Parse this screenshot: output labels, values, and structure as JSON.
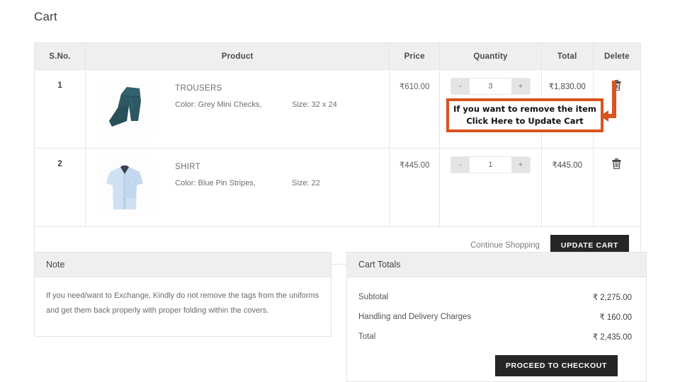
{
  "page": {
    "title": "Cart"
  },
  "table": {
    "headers": {
      "sno": "S.No.",
      "product": "Product",
      "price": "Price",
      "quantity": "Quantity",
      "total": "Total",
      "delete": "Delete"
    },
    "rows": [
      {
        "sno": "1",
        "name": "TROUSERS",
        "color": "Color: Grey Mini Checks,",
        "size": "Size: 32 x 24",
        "price": "₹610.00",
        "qty": "3",
        "total": "₹1,830.00",
        "minus": "-",
        "plus": "+",
        "image": "trousers-thumbnail"
      },
      {
        "sno": "2",
        "name": "SHIRT",
        "color": "Color: Blue Pin Stripes,",
        "size": "Size: 22",
        "price": "₹445.00",
        "qty": "1",
        "total": "₹445.00",
        "minus": "-",
        "plus": "+",
        "image": "shirt-thumbnail"
      }
    ],
    "footer": {
      "continue_shopping": "Continue Shopping",
      "update_cart": "UPDATE CART"
    }
  },
  "annotation": {
    "line1": "If you want to remove the item",
    "line2": "Click Here to Update Cart",
    "color": "#d9531e",
    "points_to": "delete-icon-row-1"
  },
  "note": {
    "heading": "Note",
    "line1": "If you need/want to Exchange, Kindly do not remove the tags from the uniforms",
    "line2": "and get them back properly with proper folding within the covers."
  },
  "totals": {
    "heading": "Cart Totals",
    "rows": [
      {
        "label": "Subtotal",
        "value": "₹ 2,275.00"
      },
      {
        "label": "Handling and Delivery Charges",
        "value": "₹ 160.00"
      },
      {
        "label": "Total",
        "value": "₹ 2,435.00"
      }
    ],
    "checkout_label": "PROCEED TO CHECKOUT"
  },
  "colors": {
    "header_bg": "#efefef",
    "border": "#e4e4e4",
    "dark_button": "#262626",
    "annotation": "#d9531e"
  }
}
